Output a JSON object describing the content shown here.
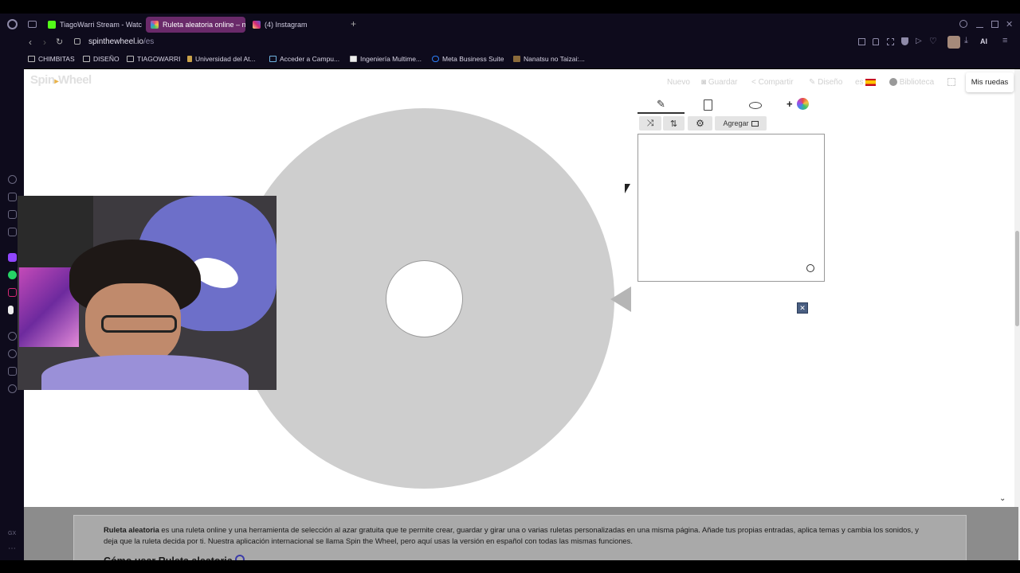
{
  "browser": {
    "tabs": [
      {
        "label": "TiagoWarri Stream - Watc",
        "active": false,
        "favicon_color": "#53fc18"
      },
      {
        "label": "Ruleta aleatoria online – n",
        "active": true,
        "favicon_color": "#e84a7f"
      },
      {
        "label": "(4) Instagram",
        "active": false,
        "favicon_color": "#d62976"
      }
    ],
    "new_tab_label": "+",
    "url_domain": "spinthewheel.io",
    "url_path": "/es",
    "ai_label": "AI",
    "bookmarks": [
      "CHIMBITAS",
      "DISEÑO",
      "TIAGOWARRI",
      "Universidad del At...",
      "Acceder a Campu...",
      "Ingeniería Multime...",
      "Meta Business Suite",
      "Nanatsu no Taizai:..."
    ],
    "sidebar_bottom_label": "GX"
  },
  "site": {
    "logo_left": "Spin",
    "logo_right": "Wheel",
    "nav": {
      "nuevo": "Nuevo",
      "guardar": "Guardar",
      "compartir": "Compartir",
      "diseno": "Diseño",
      "lang": "es",
      "biblioteca": "Biblioteca",
      "mis_ruedas": "Mis ruedas"
    },
    "editor": {
      "add_label": "+",
      "agregar_label": "Agregar",
      "textarea_value": "",
      "close_label": "✕"
    },
    "footer": {
      "lead_bold": "Ruleta aleatoria",
      "lead_text": " es una ruleta online y una herramienta de selección al azar gratuita que te permite crear, guardar y girar una o varias ruletas personalizadas en una misma página. Añade tus propias entradas, aplica temas y cambia los sonidos, y deja que la ruleta decida por ti. Nuestra aplicación internacional se llama Spin the Wheel, pero aquí usas la versión en español con todas las mismas funciones.",
      "heading": "Cómo usar Ruleta aleatoria"
    }
  },
  "colors": {
    "browser_bg": "#0e0b1c",
    "active_tab": "#6a2a6a",
    "wheel": "#cecece",
    "page_bg": "#ffffff"
  }
}
